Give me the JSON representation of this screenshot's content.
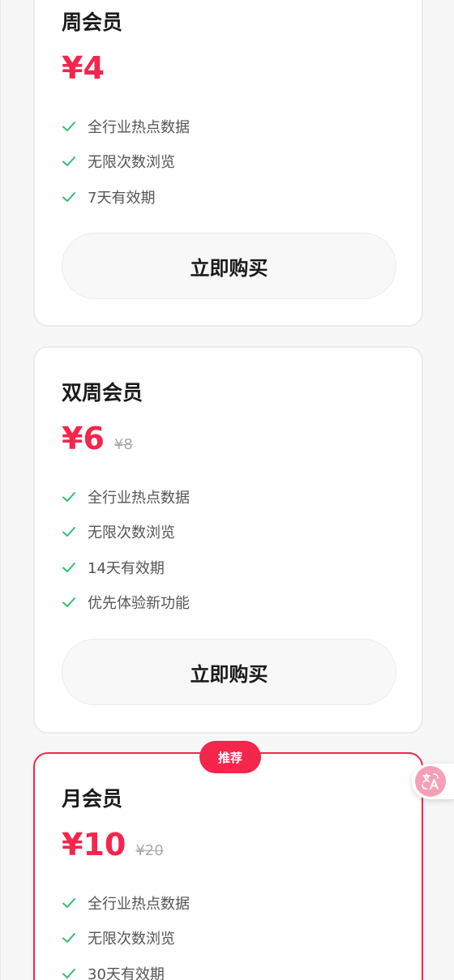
{
  "plans": [
    {
      "title": "周会员",
      "price": "¥4",
      "original_price": "",
      "features": [
        "全行业热点数据",
        "无限次数浏览",
        "7天有效期"
      ],
      "button_label": "立即购买"
    },
    {
      "title": "双周会员",
      "price": "¥6",
      "original_price": "¥8",
      "features": [
        "全行业热点数据",
        "无限次数浏览",
        "14天有效期",
        "优先体验新功能"
      ],
      "button_label": "立即购买"
    },
    {
      "title": "月会员",
      "price": "¥10",
      "original_price": "¥20",
      "badge": "推荐",
      "features": [
        "全行业热点数据",
        "无限次数浏览",
        "30天有效期"
      ]
    }
  ],
  "icons": {
    "feature_check": "check-icon",
    "translate_fab": "translate-icon"
  },
  "colors": {
    "accent": "#f5254b",
    "check": "#2fbf71",
    "background": "#f7f7f7"
  }
}
